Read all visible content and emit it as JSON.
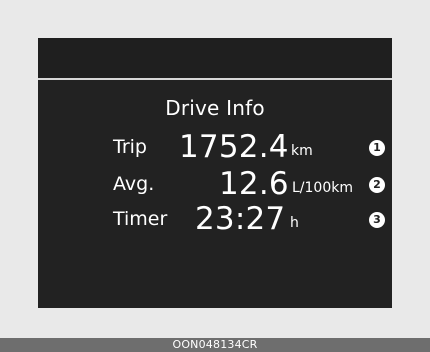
{
  "display": {
    "title": "Drive Info",
    "rows": [
      {
        "label": "Trip",
        "value": "1752.4",
        "unit": "km",
        "marker": "1"
      },
      {
        "label": "Avg.",
        "value": "12.6",
        "unit": "L/100km",
        "marker": "2"
      },
      {
        "label": "Timer",
        "value": "23:27",
        "unit": "h",
        "marker": "3"
      }
    ]
  },
  "footer": {
    "code": "OON048134CR"
  },
  "colors": {
    "screen_background": "#222222",
    "frame_background": "#e9e9e9",
    "footer_background": "#6e6e6e",
    "text": "#ffffff",
    "divider": "#d7d7d7"
  }
}
